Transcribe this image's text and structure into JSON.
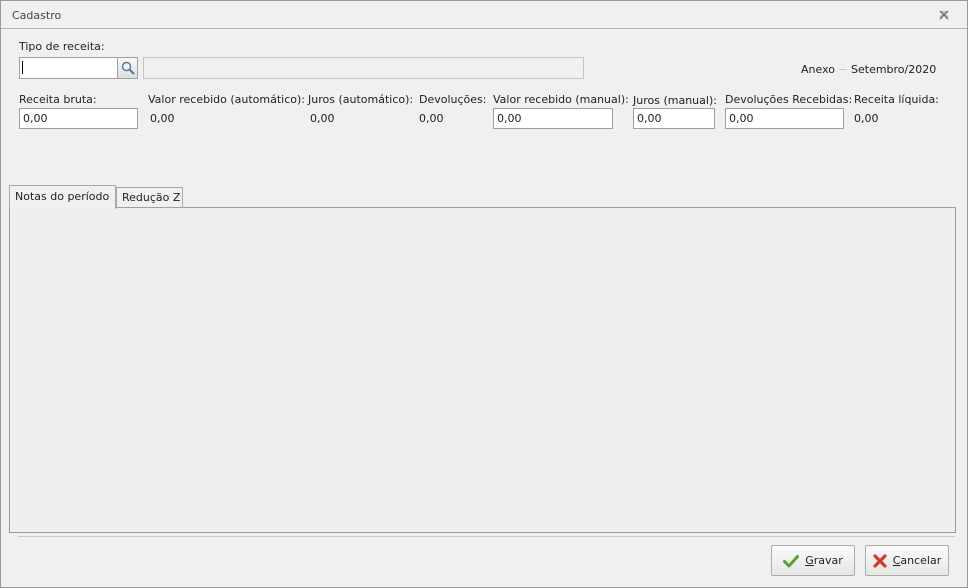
{
  "window": {
    "title": "Cadastro"
  },
  "form": {
    "tipo_receita_label": "Tipo de receita:",
    "tipo_receita_value": "",
    "tipo_receita_desc": "",
    "anexo_label": "Anexo",
    "periodo": "Setembro/2020",
    "receita_bruta_label": "Receita bruta:",
    "receita_bruta_value": "0,00",
    "valor_auto_label": "Valor recebido (automático):",
    "valor_auto_value": "0,00",
    "juros_auto_label": "Juros (automático):",
    "juros_auto_value": "0,00",
    "devolucoes_label": "Devoluções:",
    "devolucoes_value": "0,00",
    "valor_manual_label": "Valor recebido (manual):",
    "valor_manual_value": "0,00",
    "juros_manual_label": "Juros (manual):",
    "juros_manual_value": "0,00",
    "dev_recebidas_label": "Devoluções Recebidas:",
    "dev_recebidas_value": "0,00",
    "receita_liquida_label": "Receita líquida:",
    "receita_liquida_value": "0,00"
  },
  "tabs": [
    {
      "label": "Notas do período",
      "active": true
    },
    {
      "label": "Redução Z",
      "active": false
    }
  ],
  "buttons": {
    "gravar": "Gravar",
    "cancelar": "Cancelar"
  },
  "icons": {
    "search": "search-icon",
    "close": "close-icon",
    "check": "check-icon",
    "cancel": "cancel-icon"
  },
  "colors": {
    "check_green": "#5aa02c",
    "cancel_red": "#d23b2a"
  }
}
